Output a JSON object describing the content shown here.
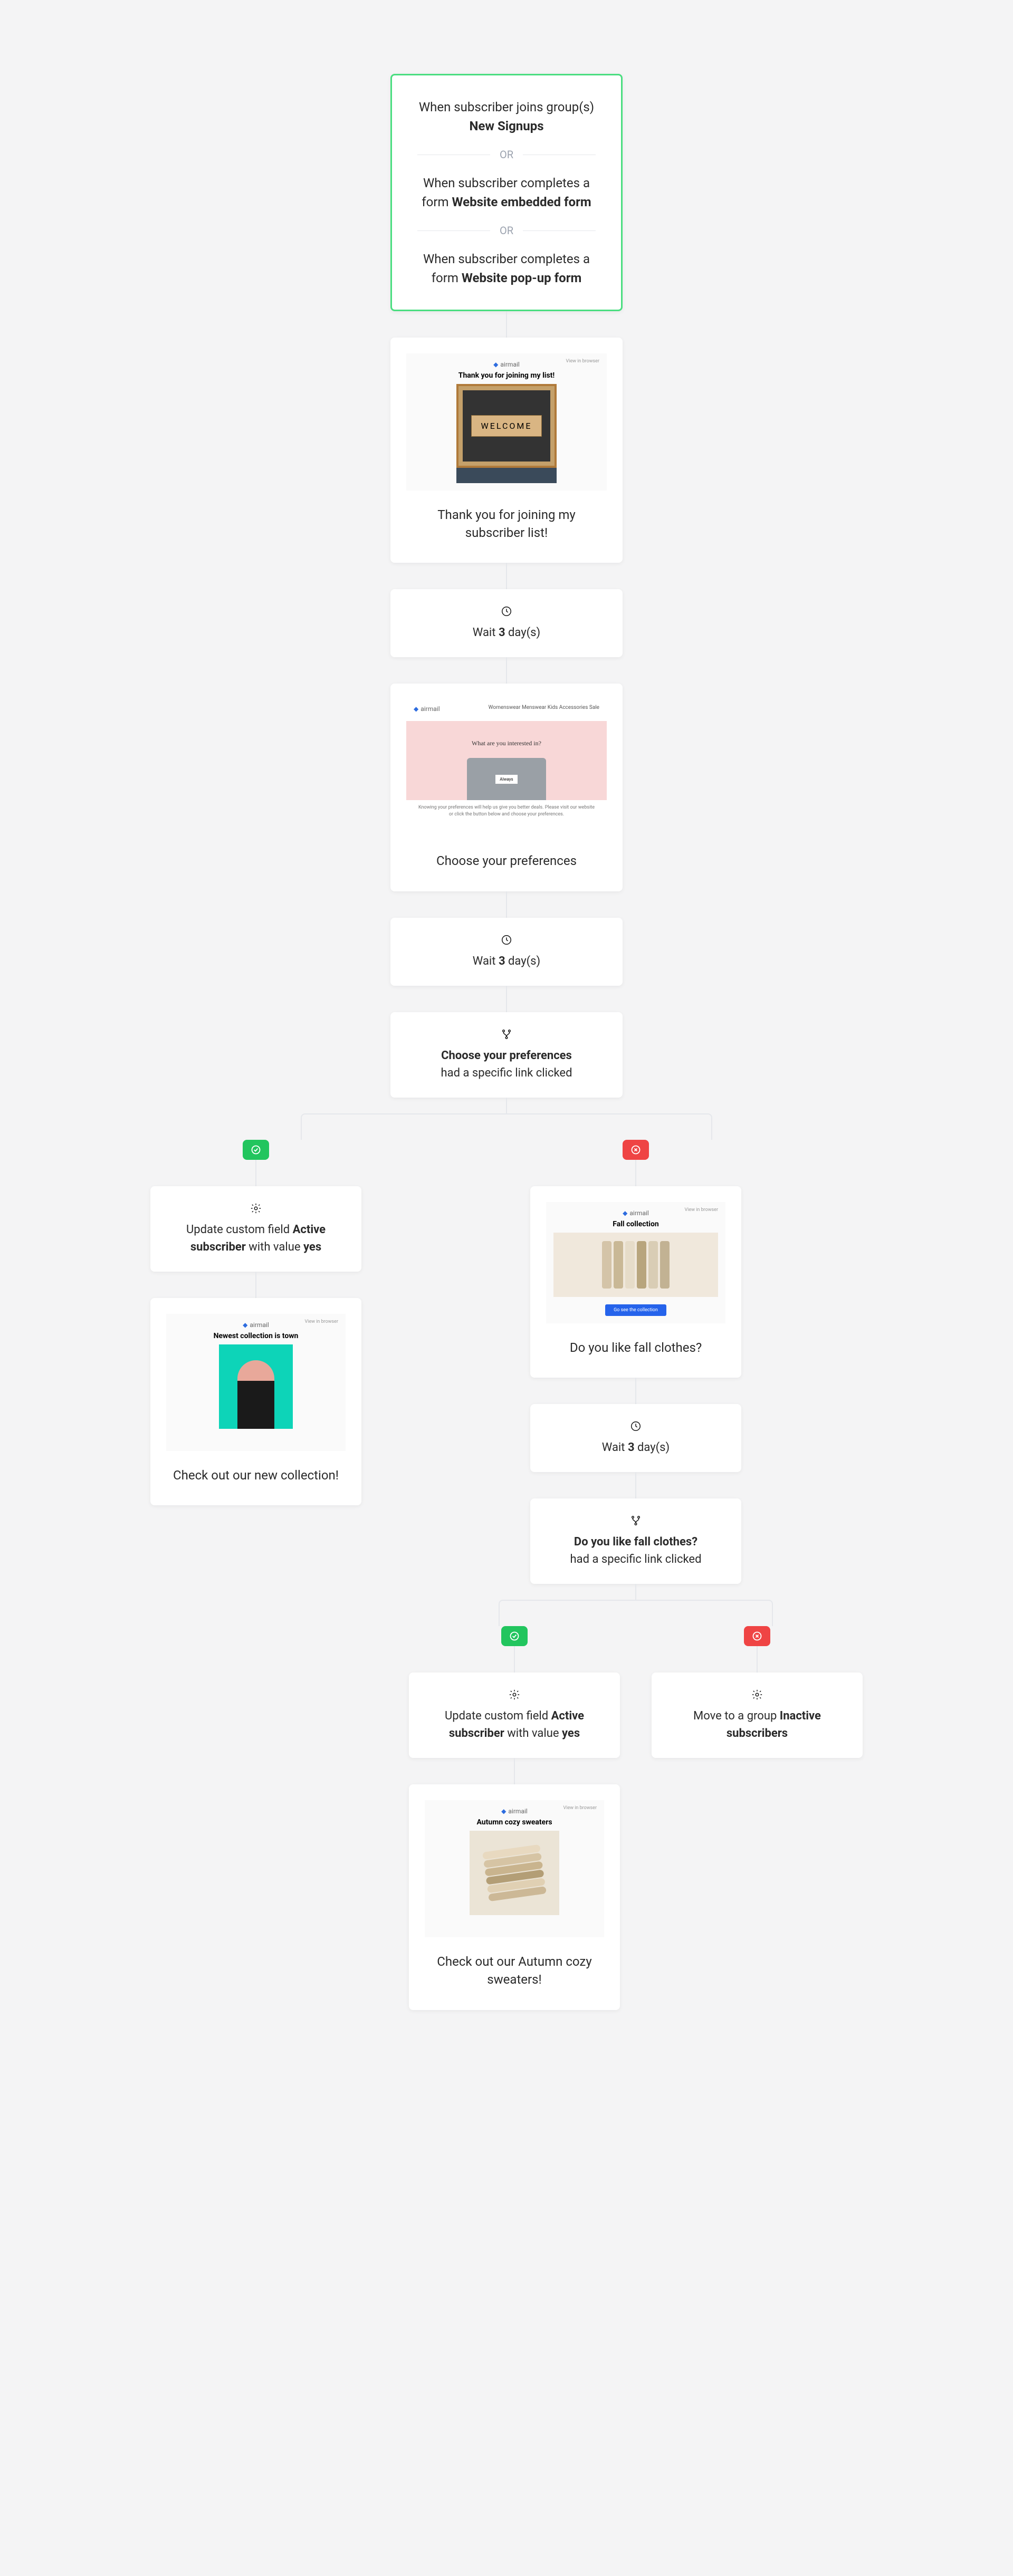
{
  "trigger": {
    "line1_pre": "When subscriber joins group(s) ",
    "line1_bold": "New Signups",
    "or": "OR",
    "line2_pre": "When subscriber completes a form ",
    "line2_bold": "Website embedded form",
    "line3_pre": "When subscriber completes a form ",
    "line3_bold": "Website pop-up form"
  },
  "email1": {
    "brand": "airmail",
    "view_online": "View in browser",
    "headline": "Thank you for joining my list!",
    "welcome": "WELCOME",
    "caption": "Thank you for joining my subscriber list!"
  },
  "wait1": {
    "pre": "Wait ",
    "bold": "3",
    "post": " day(s)"
  },
  "email2": {
    "brand": "airmail",
    "nav": "Womenswear   Menswear   Kids   Accessories   Sale",
    "question": "What are you interested in?",
    "tag": "Always",
    "desc": "Knowing your preferences will help us give you better deals. Please visit our website or click the button below and choose your preferences.",
    "caption": "Choose your preferences"
  },
  "wait2": {
    "pre": "Wait ",
    "bold": "3",
    "post": " day(s)"
  },
  "cond1": {
    "bold": "Choose your preferences",
    "sub": "had a specific link clicked"
  },
  "action_yes1": {
    "pre": "Update custom field ",
    "b1": "Active subscriber",
    "mid": " with value ",
    "b2": "yes"
  },
  "email3": {
    "brand": "airmail",
    "view_online": "View in browser",
    "headline": "Newest collection is town",
    "caption": "Check out our new collection!"
  },
  "email4": {
    "brand": "airmail",
    "view_online": "View in browser",
    "headline": "Fall collection",
    "btn": "Go see the collection",
    "caption": "Do you like fall clothes?"
  },
  "wait3": {
    "pre": "Wait ",
    "bold": "3",
    "post": " day(s)"
  },
  "cond2": {
    "bold": "Do you like fall clothes?",
    "sub": "had a specific link clicked"
  },
  "action_yes2": {
    "pre": "Update custom field ",
    "b1": "Active subscriber",
    "mid": " with value ",
    "b2": "yes"
  },
  "action_no2": {
    "pre": "Move to a group ",
    "b1": "Inactive subscribers"
  },
  "email5": {
    "brand": "airmail",
    "view_online": "View in browser",
    "headline": "Autumn cozy sweaters",
    "caption": "Check out our Autumn cozy sweaters!"
  }
}
